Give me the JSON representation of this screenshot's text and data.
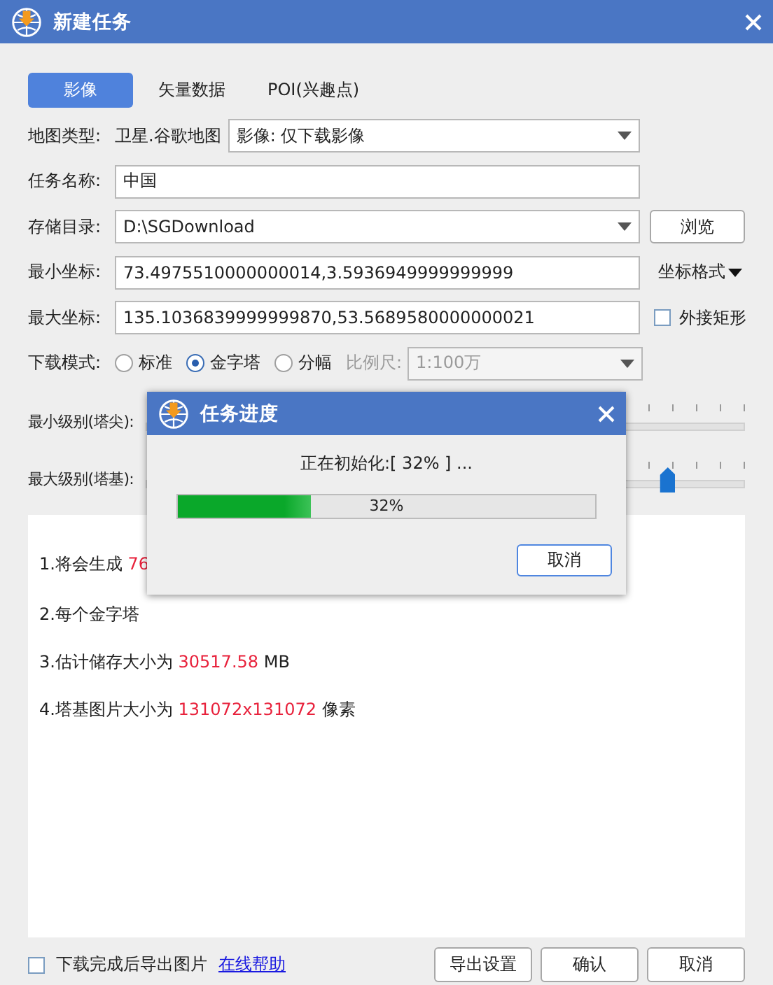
{
  "window": {
    "title": "新建任务"
  },
  "tabs": [
    {
      "label": "影像",
      "selected": true
    },
    {
      "label": "矢量数据",
      "selected": false
    },
    {
      "label": "POI(兴趣点)",
      "selected": false
    }
  ],
  "map_type": {
    "label": "地图类型:",
    "source": "卫星.谷歌地图",
    "value": "影像: 仅下载影像"
  },
  "task_name": {
    "label": "任务名称:",
    "value": "中国"
  },
  "storage": {
    "label": "存储目录:",
    "value": "D:\\SGDownload",
    "button": "浏览"
  },
  "min_coord": {
    "label": "最小坐标:",
    "value": "73.4975510000000014,3.5936949999999999",
    "button": "坐标格式"
  },
  "max_coord": {
    "label": "最大坐标:",
    "value": "135.1036839999999870,53.5689580000000021",
    "checkbox": {
      "label": "外接矩形",
      "checked": false
    }
  },
  "download_mode": {
    "label": "下载模式:",
    "options": [
      {
        "label": "标准",
        "selected": false
      },
      {
        "label": "金字塔",
        "selected": true
      },
      {
        "label": "分幅",
        "selected": false
      }
    ],
    "scale": {
      "label": "比例尺:",
      "value": "1:100万",
      "disabled": true
    }
  },
  "levels": [
    {
      "label": "最小级别(塔尖):"
    },
    {
      "label": "最大级别(塔基):",
      "level": 0.87
    }
  ],
  "info_lines": [
    {
      "parts": [
        {
          "text": "1.将会生成 ",
          "highlight": false
        },
        {
          "text": "76",
          "highlight": true
        }
      ]
    },
    {
      "parts": [
        {
          "text": "2.每个金字塔",
          "highlight": false
        }
      ]
    },
    {
      "parts": [
        {
          "text": "3.估计储存大小为 ",
          "highlight": false
        },
        {
          "text": "30517.58",
          "highlight": true
        },
        {
          "text": " MB",
          "highlight": false
        }
      ]
    },
    {
      "parts": [
        {
          "text": "4.塔基图片大小为 ",
          "highlight": false
        },
        {
          "text": "131072x131072",
          "highlight": true
        },
        {
          "text": " 像素",
          "highlight": false
        }
      ]
    }
  ],
  "footer": {
    "checkbox": {
      "label": "下载完成后导出图片",
      "checked": false
    },
    "link": "在线帮助",
    "buttons": [
      "导出设置",
      "确认",
      "取消"
    ]
  },
  "progress_dialog": {
    "title": "任务进度",
    "status": "正在初始化:[ 32% ] ...",
    "level": 0.32,
    "reading": "32%",
    "button": "取消"
  }
}
